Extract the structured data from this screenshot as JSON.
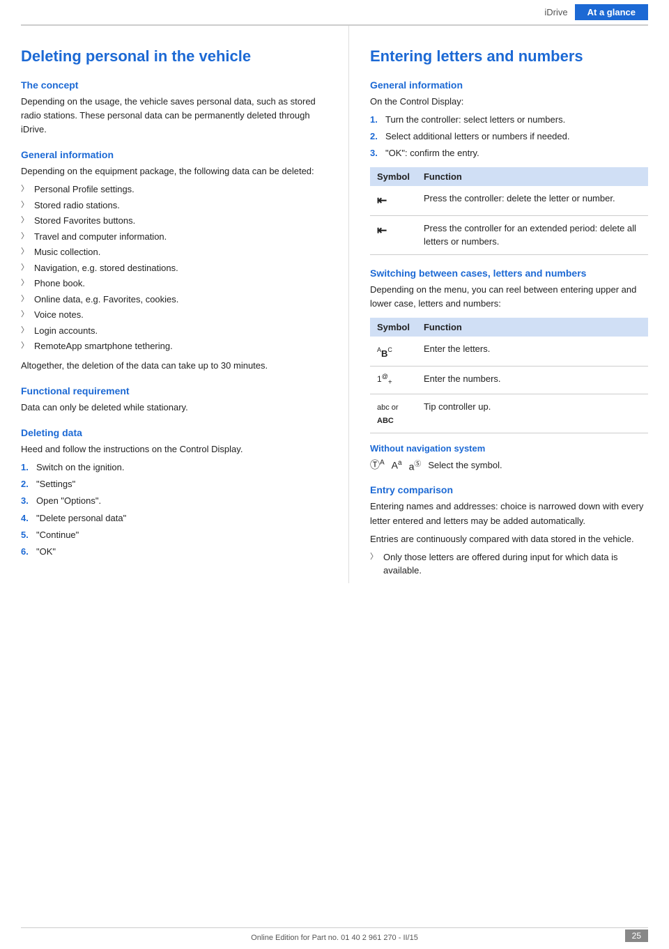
{
  "header": {
    "nav_label": "iDrive",
    "active_label": "At a glance"
  },
  "left": {
    "page_title": "Deleting personal in the vehicle",
    "concept_heading": "The concept",
    "concept_text": "Depending on the usage, the vehicle saves personal data, such as stored radio stations. These personal data can be permanently deleted through iDrive.",
    "general_info_heading": "General information",
    "general_info_text": "Depending on the equipment package, the following data can be deleted:",
    "bullet_items": [
      "Personal Profile settings.",
      "Stored radio stations.",
      "Stored Favorites buttons.",
      "Travel and computer information.",
      "Music collection.",
      "Navigation, e.g. stored destinations.",
      "Phone book.",
      "Online data, e.g. Favorites, cookies.",
      "Voice notes.",
      "Login accounts.",
      "RemoteApp smartphone tethering."
    ],
    "general_info_footer": "Altogether, the deletion of the data can take up to 30 minutes.",
    "functional_req_heading": "Functional requirement",
    "functional_req_text": "Data can only be deleted while stationary.",
    "deleting_data_heading": "Deleting data",
    "deleting_data_text": "Heed and follow the instructions on the Control Display.",
    "steps": [
      {
        "num": "1.",
        "text": "Switch on the ignition."
      },
      {
        "num": "2.",
        "text": "\"Settings\""
      },
      {
        "num": "3.",
        "text": "Open \"Options\"."
      },
      {
        "num": "4.",
        "text": "\"Delete personal data\""
      },
      {
        "num": "5.",
        "text": "\"Continue\""
      },
      {
        "num": "6.",
        "text": "\"OK\""
      }
    ]
  },
  "right": {
    "page_title": "Entering letters and numbers",
    "general_info_heading": "General information",
    "general_info_intro": "On the Control Display:",
    "steps": [
      {
        "num": "1.",
        "text": "Turn the controller: select letters or numbers."
      },
      {
        "num": "2.",
        "text": "Select additional letters or numbers if needed."
      },
      {
        "num": "3.",
        "text": "\"OK\": confirm the entry."
      }
    ],
    "table1": {
      "headers": [
        "Symbol",
        "Function"
      ],
      "rows": [
        {
          "symbol": "⊣",
          "function": "Press the controller: delete the letter or number."
        },
        {
          "symbol": "⊣",
          "function": "Press the controller for an extended period: delete all letters or numbers."
        }
      ]
    },
    "switch_heading": "Switching between cases, letters and numbers",
    "switch_text": "Depending on the menu, you can reel between entering upper and lower case, letters and numbers:",
    "table2": {
      "headers": [
        "Symbol",
        "Function"
      ],
      "rows": [
        {
          "symbol": "ABC",
          "symbol_type": "abc",
          "function": "Enter the letters."
        },
        {
          "symbol": "1@+",
          "symbol_type": "num",
          "function": "Enter the numbers."
        },
        {
          "symbol": "abc or ABC",
          "symbol_type": "abcABC",
          "function": "Tip controller up."
        }
      ]
    },
    "without_nav_heading": "Without navigation system",
    "without_nav_text": "Select the symbol.",
    "entry_comparison_heading": "Entry comparison",
    "entry_comparison_text1": "Entering names and addresses: choice is narrowed down with every letter entered and letters may be added automatically.",
    "entry_comparison_text2": "Entries are continuously compared with data stored in the vehicle.",
    "entry_comparison_bullet": "Only those letters are offered during input for which data is available."
  },
  "footer": {
    "text": "Online Edition for Part no. 01 40 2 961 270 - II/15",
    "page_number": "25"
  }
}
